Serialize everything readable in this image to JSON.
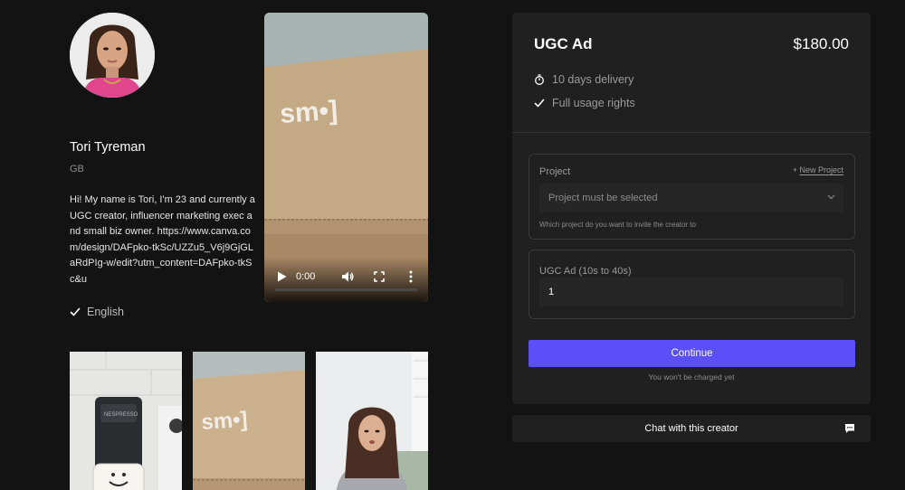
{
  "creator": {
    "name": "Tori Tyreman",
    "country": "GB",
    "bio": "Hi! My name is Tori, I'm 23 and currently a UGC creator, influencer marketing exec and small biz owner. https://www.canva.com/design/DAFpko-tkSc/UZZu5_V6j9GjGLaRdPIg-w/edit?utm_content=DAFpko-tkSc&u",
    "language": "English"
  },
  "video": {
    "time": "0:00",
    "progress": 0
  },
  "package": {
    "title": "UGC Ad",
    "price": "$180.00",
    "features": [
      {
        "icon": "stopwatch-icon",
        "text": "10 days delivery"
      },
      {
        "icon": "check-icon",
        "text": "Full usage rights"
      }
    ]
  },
  "form": {
    "project": {
      "label": "Project",
      "new_prefix": "+",
      "new_link": "New Project",
      "select_placeholder": "Project must be selected",
      "help": "Which project do you want to invite the creator to"
    },
    "quantity": {
      "label": "UGC Ad (10s to 40s)",
      "value": "1"
    },
    "continue_label": "Continue",
    "charge_note": "You won't be charged yet"
  },
  "chat": {
    "label": "Chat with this creator",
    "icon": "chat-bubble-icon"
  },
  "colors": {
    "background": "#131313",
    "card": "#202020",
    "accent": "#5b4ff7"
  }
}
